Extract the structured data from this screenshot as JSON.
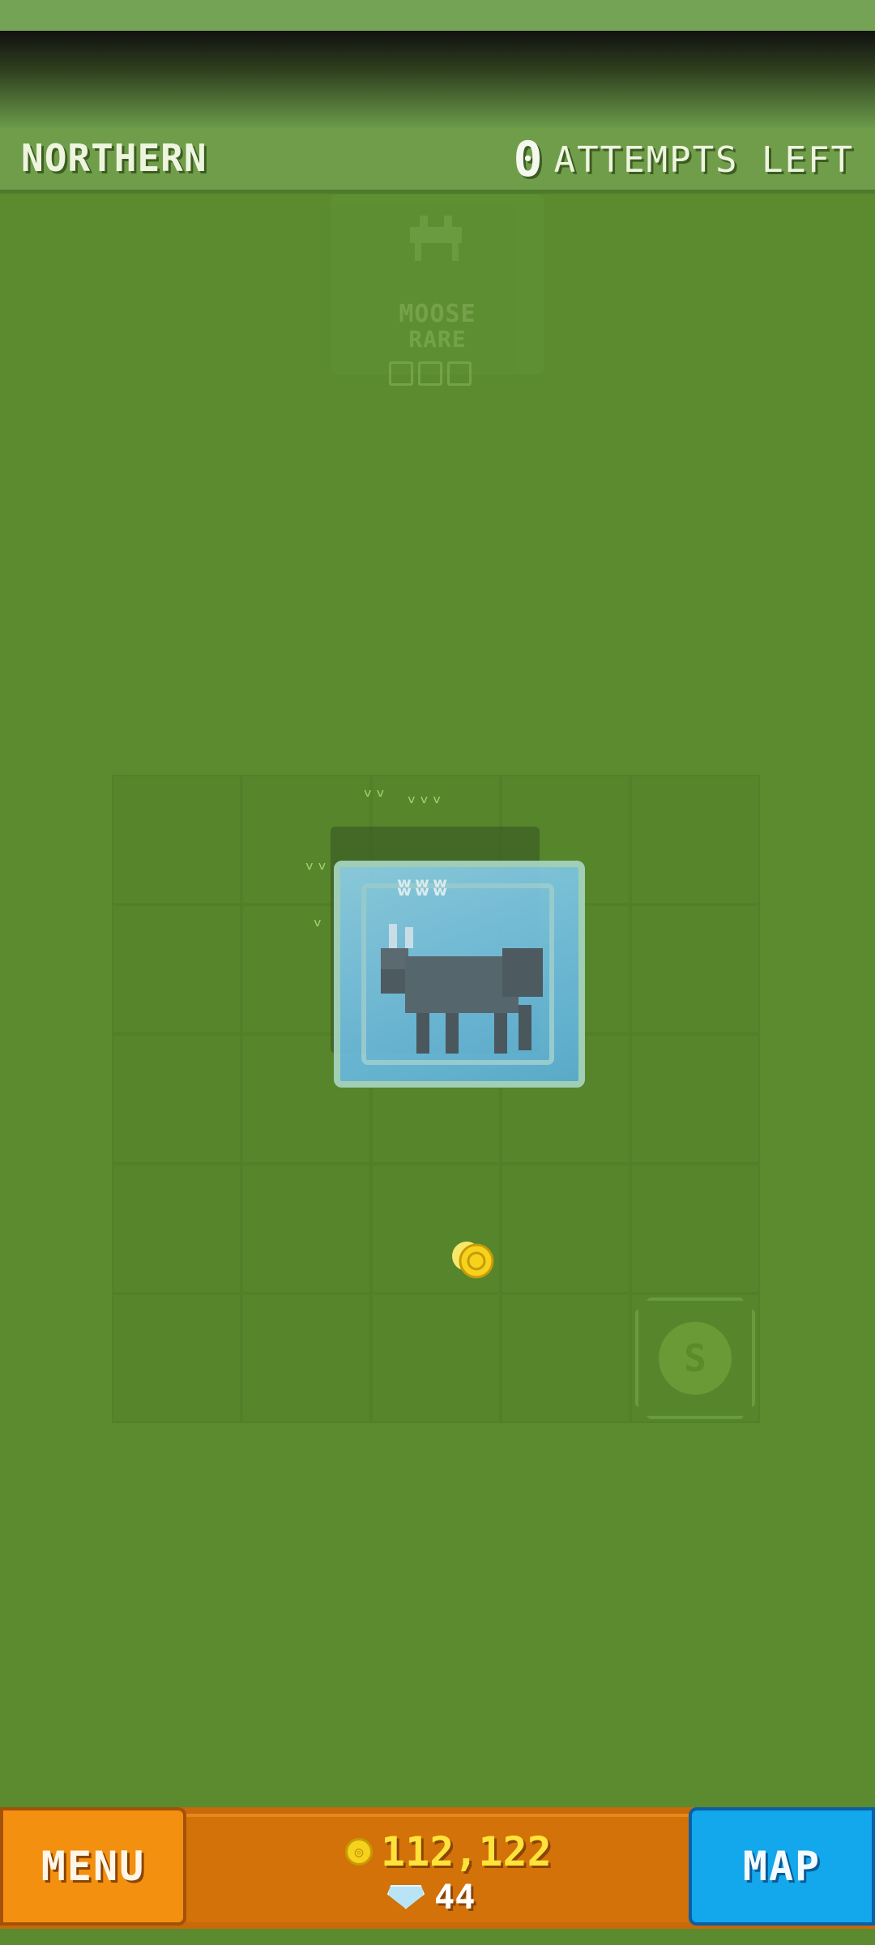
{
  "header": {
    "region": "NORTHERN",
    "attempts_count": "0",
    "attempts_label": "ATTEMPTS LEFT"
  },
  "ghost_card": {
    "animal_name": "MOOSE",
    "rarity": "RARE",
    "pips_total": 3,
    "pips_filled": 0
  },
  "grid": {
    "rows": 5,
    "cols": 5,
    "target_cell_label": "S"
  },
  "bottom_bar": {
    "menu_label": "MENU",
    "map_label": "MAP",
    "coins": "112,122",
    "gems": "44"
  },
  "colors": {
    "background": "#5b8a2f",
    "menu_button": "#f3900f",
    "map_button": "#13a7ec",
    "coin": "#ffe23a"
  },
  "icons": {
    "coin": "coin-icon",
    "gem": "gem-icon",
    "moose": "moose-icon"
  }
}
